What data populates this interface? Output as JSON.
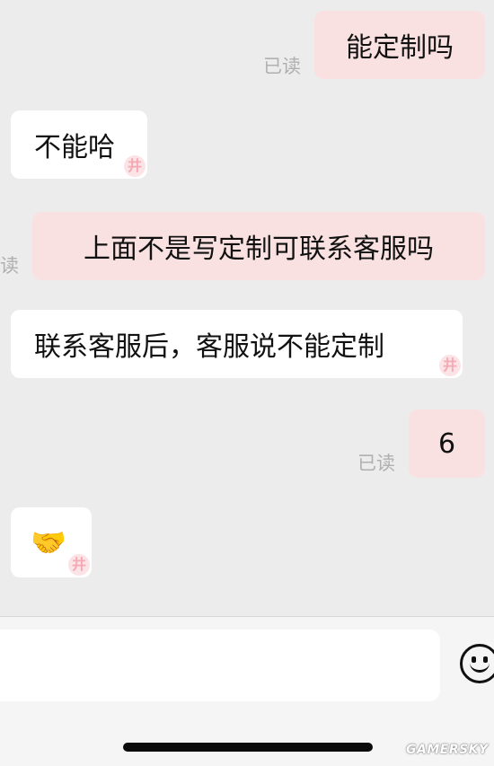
{
  "read_label": "已读",
  "read_label_partial": "读",
  "stamp_glyph": "井",
  "messages": [
    {
      "side": "out",
      "text": "能定制吗"
    },
    {
      "side": "in",
      "text": "不能哈"
    },
    {
      "side": "out",
      "text": "上面不是写定制可联系客服吗"
    },
    {
      "side": "in",
      "text": "联系客服后，客服说不能定制"
    },
    {
      "side": "out",
      "text": "6"
    },
    {
      "side": "in",
      "text": "🤝"
    }
  ],
  "input": {
    "placeholder": ""
  },
  "icons": {
    "emoji_button": "smiley-face-icon"
  },
  "watermark": "GAMERSKY",
  "colors": {
    "background": "#ececec",
    "outgoing_bubble": "#f9e1e1",
    "incoming_bubble": "#ffffff",
    "read_text": "#b0b0b0"
  }
}
